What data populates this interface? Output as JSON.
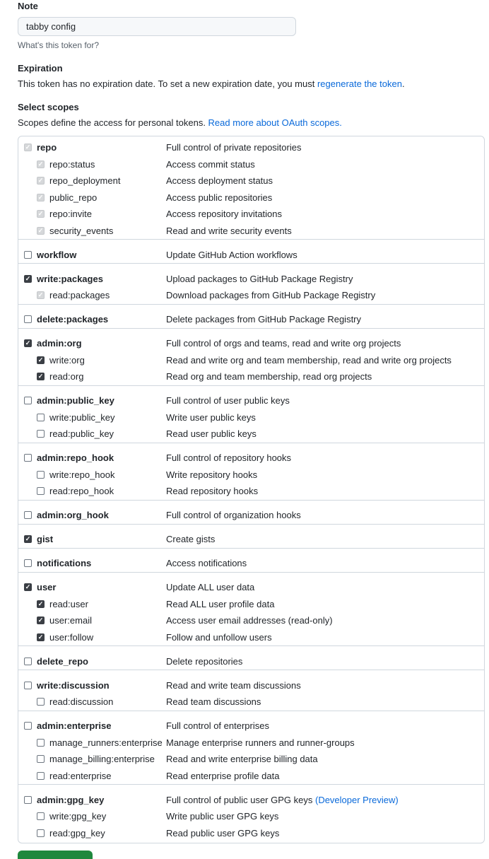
{
  "note": {
    "label": "Note",
    "value": "tabby config",
    "hint": "What's this token for?"
  },
  "expiration": {
    "label": "Expiration",
    "text": "This token has no expiration date. To set a new expiration date, you must ",
    "link": "regenerate the token",
    "text_end": "."
  },
  "scopes": {
    "label": "Select scopes",
    "text": "Scopes define the access for personal tokens. ",
    "link": "Read more about OAuth scopes."
  },
  "scope_groups": [
    {
      "name": "repo",
      "desc": "Full control of private repositories",
      "state": "disabled",
      "children": [
        {
          "name": "repo:status",
          "desc": "Access commit status",
          "state": "disabled"
        },
        {
          "name": "repo_deployment",
          "desc": "Access deployment status",
          "state": "disabled"
        },
        {
          "name": "public_repo",
          "desc": "Access public repositories",
          "state": "disabled"
        },
        {
          "name": "repo:invite",
          "desc": "Access repository invitations",
          "state": "disabled"
        },
        {
          "name": "security_events",
          "desc": "Read and write security events",
          "state": "disabled"
        }
      ]
    },
    {
      "name": "workflow",
      "desc": "Update GitHub Action workflows",
      "state": "unchecked",
      "children": []
    },
    {
      "name": "write:packages",
      "desc": "Upload packages to GitHub Package Registry",
      "state": "checked",
      "children": [
        {
          "name": "read:packages",
          "desc": "Download packages from GitHub Package Registry",
          "state": "disabled"
        }
      ]
    },
    {
      "name": "delete:packages",
      "desc": "Delete packages from GitHub Package Registry",
      "state": "unchecked",
      "children": []
    },
    {
      "name": "admin:org",
      "desc": "Full control of orgs and teams, read and write org projects",
      "state": "checked",
      "children": [
        {
          "name": "write:org",
          "desc": "Read and write org and team membership, read and write org projects",
          "state": "checked"
        },
        {
          "name": "read:org",
          "desc": "Read org and team membership, read org projects",
          "state": "checked"
        }
      ]
    },
    {
      "name": "admin:public_key",
      "desc": "Full control of user public keys",
      "state": "unchecked",
      "children": [
        {
          "name": "write:public_key",
          "desc": "Write user public keys",
          "state": "unchecked"
        },
        {
          "name": "read:public_key",
          "desc": "Read user public keys",
          "state": "unchecked"
        }
      ]
    },
    {
      "name": "admin:repo_hook",
      "desc": "Full control of repository hooks",
      "state": "unchecked",
      "children": [
        {
          "name": "write:repo_hook",
          "desc": "Write repository hooks",
          "state": "unchecked"
        },
        {
          "name": "read:repo_hook",
          "desc": "Read repository hooks",
          "state": "unchecked"
        }
      ]
    },
    {
      "name": "admin:org_hook",
      "desc": "Full control of organization hooks",
      "state": "unchecked",
      "children": []
    },
    {
      "name": "gist",
      "desc": "Create gists",
      "state": "checked",
      "children": []
    },
    {
      "name": "notifications",
      "desc": "Access notifications",
      "state": "unchecked",
      "children": []
    },
    {
      "name": "user",
      "desc": "Update ALL user data",
      "state": "checked",
      "children": [
        {
          "name": "read:user",
          "desc": "Read ALL user profile data",
          "state": "checked"
        },
        {
          "name": "user:email",
          "desc": "Access user email addresses (read-only)",
          "state": "checked"
        },
        {
          "name": "user:follow",
          "desc": "Follow and unfollow users",
          "state": "checked"
        }
      ]
    },
    {
      "name": "delete_repo",
      "desc": "Delete repositories",
      "state": "unchecked",
      "children": []
    },
    {
      "name": "write:discussion",
      "desc": "Read and write team discussions",
      "state": "unchecked",
      "children": [
        {
          "name": "read:discussion",
          "desc": "Read team discussions",
          "state": "unchecked"
        }
      ]
    },
    {
      "name": "admin:enterprise",
      "desc": "Full control of enterprises",
      "state": "unchecked",
      "children": [
        {
          "name": "manage_runners:enterprise",
          "desc": "Manage enterprise runners and runner-groups",
          "state": "unchecked"
        },
        {
          "name": "manage_billing:enterprise",
          "desc": "Read and write enterprise billing data",
          "state": "unchecked"
        },
        {
          "name": "read:enterprise",
          "desc": "Read enterprise profile data",
          "state": "unchecked"
        }
      ]
    },
    {
      "name": "admin:gpg_key",
      "desc": "Full control of public user GPG keys ",
      "desc_link": "(Developer Preview)",
      "state": "unchecked",
      "children": [
        {
          "name": "write:gpg_key",
          "desc": "Write public user GPG keys",
          "state": "unchecked"
        },
        {
          "name": "read:gpg_key",
          "desc": "Read public user GPG keys",
          "state": "unchecked"
        }
      ]
    }
  ]
}
